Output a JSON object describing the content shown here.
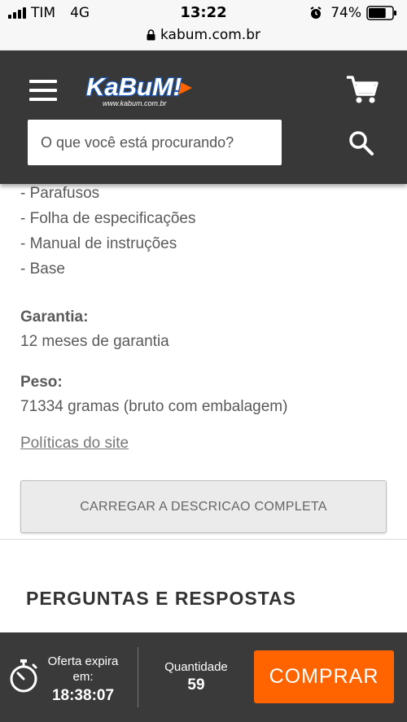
{
  "status_bar": {
    "carrier": "TIM",
    "network": "4G",
    "time": "13:22",
    "battery": "74%",
    "battery_level": 0.74
  },
  "browser": {
    "url": "kabum.com.br"
  },
  "header": {
    "logo_text": "KaBuM!",
    "logo_subtext": "www.kabum.com.br",
    "brand_color": "#ff6400",
    "search_placeholder": "O que você está procurando?"
  },
  "content": {
    "items": [
      "- Parafusos",
      "- Folha de especificações",
      "- Manual de instruções",
      "- Base"
    ],
    "warranty": {
      "label": "Garantia:",
      "value": "12 meses de garantia"
    },
    "weight": {
      "label": "Peso:",
      "value": "71334 gramas (bruto com embalagem)"
    },
    "policies_link": "Políticas do site",
    "load_button": "CARREGAR A DESCRICAO COMPLETA",
    "qa_heading": "PERGUNTAS E RESPOSTAS"
  },
  "bottom_bar": {
    "offer_label_1": "Oferta expira",
    "offer_label_2": "em:",
    "offer_time": "18:38:07",
    "quantity_label": "Quantidade",
    "quantity_value": "59",
    "buy_button": "COMPRAR"
  }
}
